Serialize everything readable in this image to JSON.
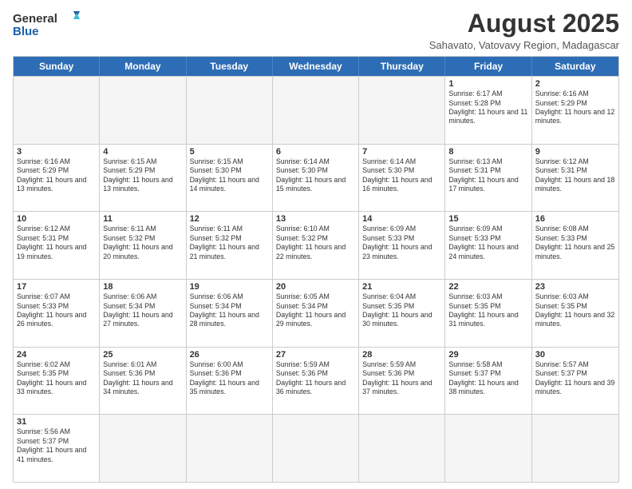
{
  "logo": {
    "text_general": "General",
    "text_blue": "Blue"
  },
  "header": {
    "month_year": "August 2025",
    "subtitle": "Sahavato, Vatovavy Region, Madagascar"
  },
  "day_headers": [
    "Sunday",
    "Monday",
    "Tuesday",
    "Wednesday",
    "Thursday",
    "Friday",
    "Saturday"
  ],
  "weeks": [
    [
      {
        "date": "",
        "info": ""
      },
      {
        "date": "",
        "info": ""
      },
      {
        "date": "",
        "info": ""
      },
      {
        "date": "",
        "info": ""
      },
      {
        "date": "",
        "info": ""
      },
      {
        "date": "1",
        "info": "Sunrise: 6:17 AM\nSunset: 5:28 PM\nDaylight: 11 hours and 11 minutes."
      },
      {
        "date": "2",
        "info": "Sunrise: 6:16 AM\nSunset: 5:29 PM\nDaylight: 11 hours and 12 minutes."
      }
    ],
    [
      {
        "date": "3",
        "info": "Sunrise: 6:16 AM\nSunset: 5:29 PM\nDaylight: 11 hours and 13 minutes."
      },
      {
        "date": "4",
        "info": "Sunrise: 6:15 AM\nSunset: 5:29 PM\nDaylight: 11 hours and 13 minutes."
      },
      {
        "date": "5",
        "info": "Sunrise: 6:15 AM\nSunset: 5:30 PM\nDaylight: 11 hours and 14 minutes."
      },
      {
        "date": "6",
        "info": "Sunrise: 6:14 AM\nSunset: 5:30 PM\nDaylight: 11 hours and 15 minutes."
      },
      {
        "date": "7",
        "info": "Sunrise: 6:14 AM\nSunset: 5:30 PM\nDaylight: 11 hours and 16 minutes."
      },
      {
        "date": "8",
        "info": "Sunrise: 6:13 AM\nSunset: 5:31 PM\nDaylight: 11 hours and 17 minutes."
      },
      {
        "date": "9",
        "info": "Sunrise: 6:12 AM\nSunset: 5:31 PM\nDaylight: 11 hours and 18 minutes."
      }
    ],
    [
      {
        "date": "10",
        "info": "Sunrise: 6:12 AM\nSunset: 5:31 PM\nDaylight: 11 hours and 19 minutes."
      },
      {
        "date": "11",
        "info": "Sunrise: 6:11 AM\nSunset: 5:32 PM\nDaylight: 11 hours and 20 minutes."
      },
      {
        "date": "12",
        "info": "Sunrise: 6:11 AM\nSunset: 5:32 PM\nDaylight: 11 hours and 21 minutes."
      },
      {
        "date": "13",
        "info": "Sunrise: 6:10 AM\nSunset: 5:32 PM\nDaylight: 11 hours and 22 minutes."
      },
      {
        "date": "14",
        "info": "Sunrise: 6:09 AM\nSunset: 5:33 PM\nDaylight: 11 hours and 23 minutes."
      },
      {
        "date": "15",
        "info": "Sunrise: 6:09 AM\nSunset: 5:33 PM\nDaylight: 11 hours and 24 minutes."
      },
      {
        "date": "16",
        "info": "Sunrise: 6:08 AM\nSunset: 5:33 PM\nDaylight: 11 hours and 25 minutes."
      }
    ],
    [
      {
        "date": "17",
        "info": "Sunrise: 6:07 AM\nSunset: 5:33 PM\nDaylight: 11 hours and 26 minutes."
      },
      {
        "date": "18",
        "info": "Sunrise: 6:06 AM\nSunset: 5:34 PM\nDaylight: 11 hours and 27 minutes."
      },
      {
        "date": "19",
        "info": "Sunrise: 6:06 AM\nSunset: 5:34 PM\nDaylight: 11 hours and 28 minutes."
      },
      {
        "date": "20",
        "info": "Sunrise: 6:05 AM\nSunset: 5:34 PM\nDaylight: 11 hours and 29 minutes."
      },
      {
        "date": "21",
        "info": "Sunrise: 6:04 AM\nSunset: 5:35 PM\nDaylight: 11 hours and 30 minutes."
      },
      {
        "date": "22",
        "info": "Sunrise: 6:03 AM\nSunset: 5:35 PM\nDaylight: 11 hours and 31 minutes."
      },
      {
        "date": "23",
        "info": "Sunrise: 6:03 AM\nSunset: 5:35 PM\nDaylight: 11 hours and 32 minutes."
      }
    ],
    [
      {
        "date": "24",
        "info": "Sunrise: 6:02 AM\nSunset: 5:35 PM\nDaylight: 11 hours and 33 minutes."
      },
      {
        "date": "25",
        "info": "Sunrise: 6:01 AM\nSunset: 5:36 PM\nDaylight: 11 hours and 34 minutes."
      },
      {
        "date": "26",
        "info": "Sunrise: 6:00 AM\nSunset: 5:36 PM\nDaylight: 11 hours and 35 minutes."
      },
      {
        "date": "27",
        "info": "Sunrise: 5:59 AM\nSunset: 5:36 PM\nDaylight: 11 hours and 36 minutes."
      },
      {
        "date": "28",
        "info": "Sunrise: 5:59 AM\nSunset: 5:36 PM\nDaylight: 11 hours and 37 minutes."
      },
      {
        "date": "29",
        "info": "Sunrise: 5:58 AM\nSunset: 5:37 PM\nDaylight: 11 hours and 38 minutes."
      },
      {
        "date": "30",
        "info": "Sunrise: 5:57 AM\nSunset: 5:37 PM\nDaylight: 11 hours and 39 minutes."
      }
    ],
    [
      {
        "date": "31",
        "info": "Sunrise: 5:56 AM\nSunset: 5:37 PM\nDaylight: 11 hours and 41 minutes."
      },
      {
        "date": "",
        "info": ""
      },
      {
        "date": "",
        "info": ""
      },
      {
        "date": "",
        "info": ""
      },
      {
        "date": "",
        "info": ""
      },
      {
        "date": "",
        "info": ""
      },
      {
        "date": "",
        "info": ""
      }
    ]
  ]
}
